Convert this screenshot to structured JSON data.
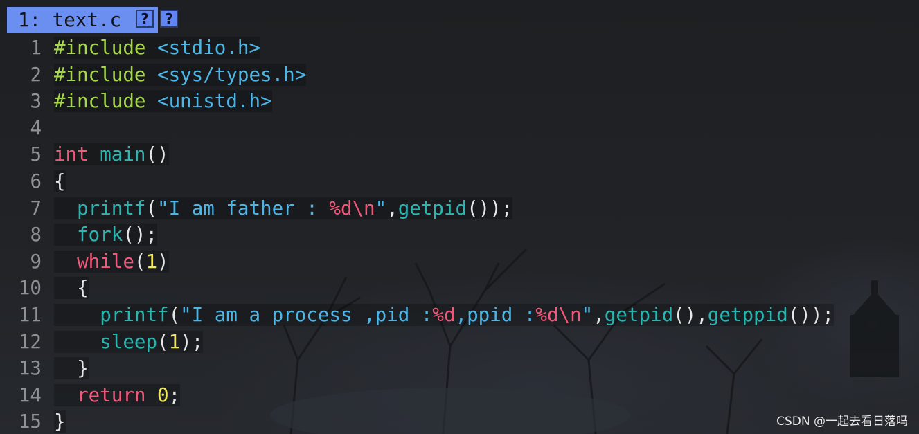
{
  "tab": {
    "label": "1: text.c",
    "icon_1": "?",
    "icon_2": "?"
  },
  "lines": [
    {
      "n": "1",
      "tokens": [
        [
          "pp",
          "#include"
        ],
        [
          "pun",
          " "
        ],
        [
          "inc",
          "<stdio.h>"
        ]
      ]
    },
    {
      "n": "2",
      "tokens": [
        [
          "pp",
          "#include"
        ],
        [
          "pun",
          " "
        ],
        [
          "inc",
          "<sys/types.h>"
        ]
      ]
    },
    {
      "n": "3",
      "tokens": [
        [
          "pp",
          "#include"
        ],
        [
          "pun",
          " "
        ],
        [
          "inc",
          "<unistd.h>"
        ]
      ]
    },
    {
      "n": "4",
      "tokens": []
    },
    {
      "n": "5",
      "tokens": [
        [
          "kw",
          "int"
        ],
        [
          "pun",
          " "
        ],
        [
          "fn",
          "main"
        ],
        [
          "pun",
          "()"
        ]
      ]
    },
    {
      "n": "6",
      "tokens": [
        [
          "pun",
          "{"
        ]
      ]
    },
    {
      "n": "7",
      "tokens": [
        [
          "pun",
          "  "
        ],
        [
          "fn",
          "printf"
        ],
        [
          "pun",
          "("
        ],
        [
          "str",
          "\"I am father : "
        ],
        [
          "fmt",
          "%d\\n"
        ],
        [
          "str",
          "\""
        ],
        [
          "pun",
          ","
        ],
        [
          "fn",
          "getpid"
        ],
        [
          "pun",
          "());"
        ]
      ]
    },
    {
      "n": "8",
      "tokens": [
        [
          "pun",
          "  "
        ],
        [
          "fn",
          "fork"
        ],
        [
          "pun",
          "();"
        ]
      ]
    },
    {
      "n": "9",
      "tokens": [
        [
          "pun",
          "  "
        ],
        [
          "kw",
          "while"
        ],
        [
          "pun",
          "("
        ],
        [
          "num",
          "1"
        ],
        [
          "pun",
          ")"
        ]
      ]
    },
    {
      "n": "10",
      "tokens": [
        [
          "pun",
          "  {"
        ]
      ]
    },
    {
      "n": "11",
      "tokens": [
        [
          "pun",
          "    "
        ],
        [
          "fn",
          "printf"
        ],
        [
          "pun",
          "("
        ],
        [
          "str",
          "\"I am a process ,pid :"
        ],
        [
          "fmt",
          "%d"
        ],
        [
          "str",
          ",ppid :"
        ],
        [
          "fmt",
          "%d\\n"
        ],
        [
          "str",
          "\""
        ],
        [
          "pun",
          ","
        ],
        [
          "fn",
          "getpid"
        ],
        [
          "pun",
          "(),"
        ],
        [
          "fn",
          "getppid"
        ],
        [
          "pun",
          "());"
        ]
      ]
    },
    {
      "n": "12",
      "tokens": [
        [
          "pun",
          "    "
        ],
        [
          "fn",
          "sleep"
        ],
        [
          "pun",
          "("
        ],
        [
          "num",
          "1"
        ],
        [
          "pun",
          ");"
        ]
      ]
    },
    {
      "n": "13",
      "tokens": [
        [
          "pun",
          "  }"
        ]
      ]
    },
    {
      "n": "14",
      "tokens": [
        [
          "pun",
          "  "
        ],
        [
          "kw",
          "return"
        ],
        [
          "pun",
          " "
        ],
        [
          "num",
          "0"
        ],
        [
          "pun",
          ";"
        ]
      ]
    },
    {
      "n": "15",
      "tokens": [
        [
          "pun",
          "}"
        ]
      ]
    }
  ],
  "watermark": "CSDN @一起去看日落吗",
  "colors": {
    "tab_bg": "#6b8ff0",
    "preprocessor": "#a6d64a",
    "include_path": "#4db6e6",
    "keyword": "#f2587a",
    "function": "#2ab5b0",
    "string": "#4db6e6",
    "format_specifier": "#f2587a",
    "number": "#f2e85a",
    "line_number": "#8e9196"
  }
}
